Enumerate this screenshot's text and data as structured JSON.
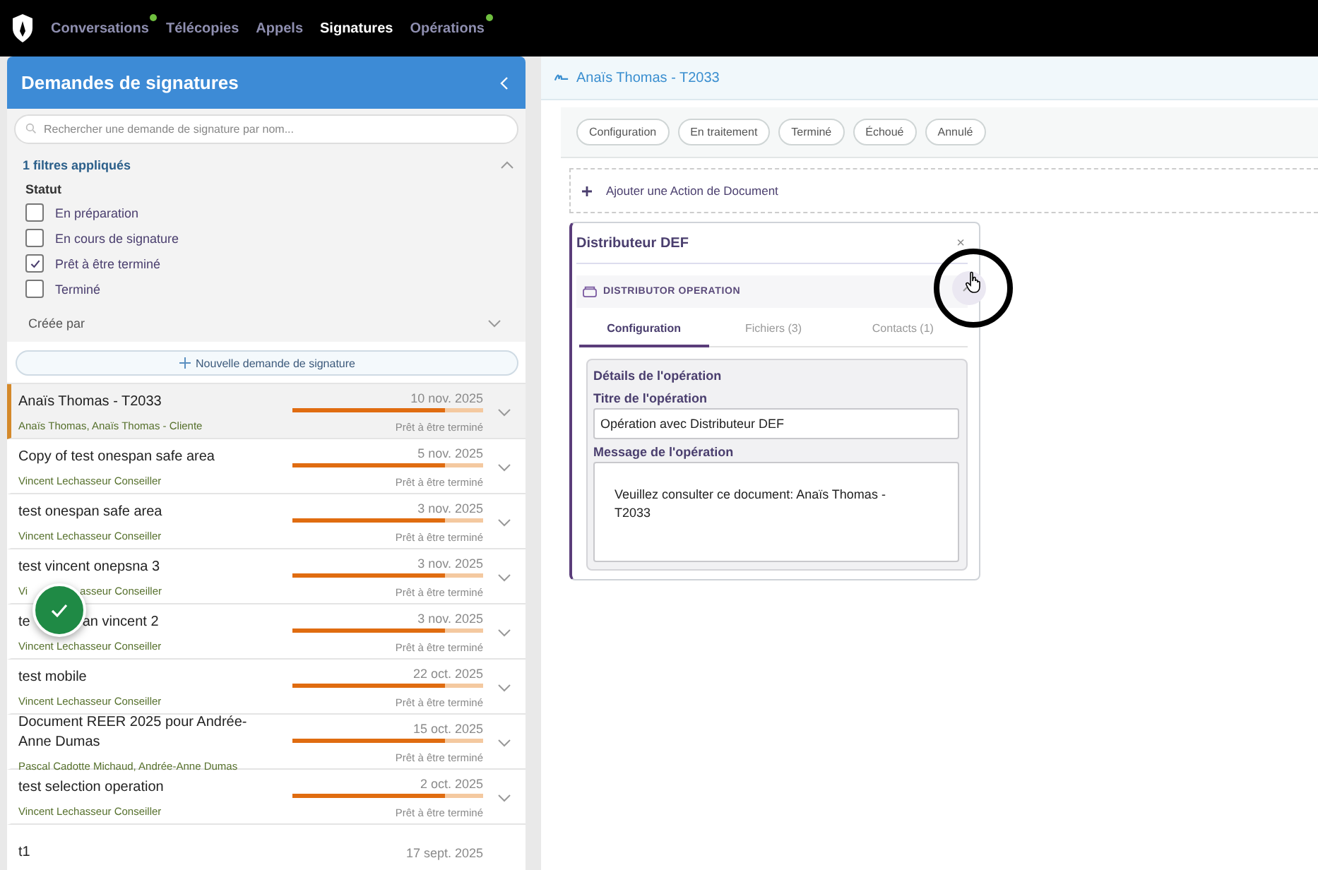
{
  "nav": {
    "items": [
      {
        "label": "Conversations",
        "selected": false,
        "notification": true
      },
      {
        "label": "Télécopies",
        "selected": false,
        "notification": false
      },
      {
        "label": "Appels",
        "selected": false,
        "notification": false
      },
      {
        "label": "Signatures",
        "selected": true,
        "notification": false
      },
      {
        "label": "Opérations",
        "selected": false,
        "notification": true
      }
    ]
  },
  "sidebar": {
    "title": "Demandes de signatures",
    "search": {
      "placeholder": "Rechercher une demande de signature par nom..."
    },
    "filters": {
      "summary": "1 filtres appliqués",
      "expanded": true,
      "group": "Statut",
      "options": [
        {
          "label": "En préparation",
          "checked": false
        },
        {
          "label": "En cours de signature",
          "checked": false
        },
        {
          "label": "Prêt à être terminé",
          "checked": true
        },
        {
          "label": "Terminé",
          "checked": false
        }
      ],
      "created_by": "Créée par"
    },
    "new_button": "Nouvelle demande de signature",
    "rows": [
      {
        "title_parts": [
          "Anaïs Thomas - T2033"
        ],
        "date": "10 nov. 2025",
        "level": 0.8,
        "subtitle_parts": [
          "Anaïs Thomas, Anaïs Thomas - Cliente"
        ],
        "status": "Prêt à être terminé",
        "selected": true
      },
      {
        "title_parts": [
          "Copy of test onespan safe area"
        ],
        "date": "5 nov. 2025",
        "level": 0.8,
        "subtitle_parts": [
          "Vincent Lechasseur Conseiller"
        ],
        "status": "Prêt à être terminé",
        "selected": false
      },
      {
        "title_parts": [
          "test onespan safe area"
        ],
        "date": "3 nov. 2025",
        "level": 0.8,
        "subtitle_parts": [
          "Vincent Lechasseur Conseiller"
        ],
        "status": "Prêt à être terminé",
        "selected": false
      },
      {
        "title_parts": [
          "test vincent onepsna 3"
        ],
        "date": "3 nov. 2025",
        "level": 0.8,
        "subtitle_parts": [
          "Vi",
          "asseur Conseiller"
        ],
        "status": "Prêt à être terminé",
        "selected": false
      },
      {
        "title_parts": [
          "te",
          "an vincent 2"
        ],
        "date": "3 nov. 2025",
        "level": 0.8,
        "subtitle_parts": [
          "Vincent Lechasseur Conseiller"
        ],
        "status": "Prêt à être terminé",
        "selected": false
      },
      {
        "title_parts": [
          "test mobile"
        ],
        "date": "22 oct. 2025",
        "level": 0.8,
        "subtitle_parts": [
          "Vincent Lechasseur Conseiller"
        ],
        "status": "Prêt à être terminé",
        "selected": false
      },
      {
        "title_parts": [
          "Document REER 2025 pour Andrée-Anne Dumas"
        ],
        "date": "15 oct. 2025",
        "level": 0.8,
        "subtitle_parts": [
          "Pascal Cadotte Michaud, Andrée-Anne Dumas"
        ],
        "status": "Prêt à être terminé",
        "selected": false
      },
      {
        "title_parts": [
          "test selection operation"
        ],
        "date": "2 oct. 2025",
        "level": 0.8,
        "subtitle_parts": [
          "Vincent Lechasseur Conseiller"
        ],
        "status": "Prêt à être terminé",
        "selected": false
      },
      {
        "title_parts": [
          "t1"
        ],
        "date": "17 sept. 2025",
        "selected": false
      }
    ]
  },
  "detail": {
    "title": "Anaïs Thomas - T2033",
    "status_filters": [
      "Configuration",
      "En traitement",
      "Terminé",
      "Échoué",
      "Annulé"
    ],
    "add_action": "Ajouter une Action de Document",
    "card": {
      "title": "Distributeur DEF",
      "close": "×",
      "section": "DISTRIBUTOR OPERATION",
      "expanded": true,
      "tabs": [
        {
          "label": "Configuration",
          "selected": true
        },
        {
          "label": "Fichiers (3)",
          "selected": false
        },
        {
          "label": "Contacts (1)",
          "selected": false
        }
      ],
      "group_title": "Détails de l'opération",
      "fields": [
        {
          "kind": "text",
          "label": "Titre de l'opération",
          "value": "Opération avec Distributeur DEF"
        },
        {
          "kind": "textarea",
          "label": "Message de l'opération",
          "value": "Veuillez consulter ce document: Anaïs Thomas - T2033"
        }
      ]
    }
  }
}
